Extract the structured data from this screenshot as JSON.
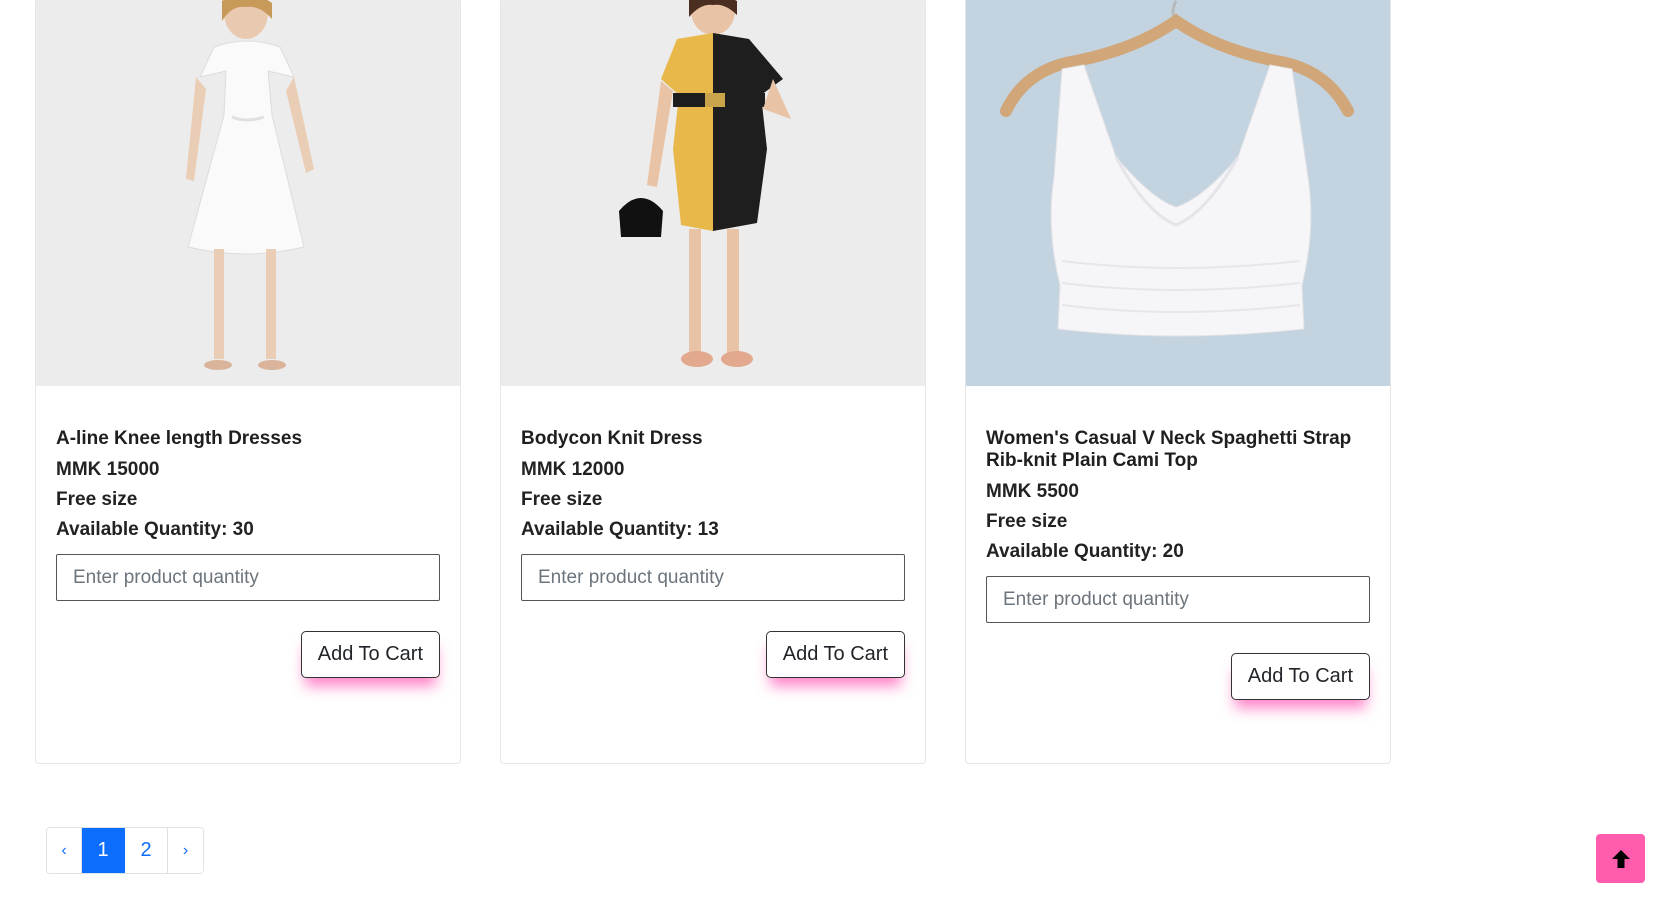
{
  "products": [
    {
      "name": "A-line Knee length Dresses",
      "price": "MMK 15000",
      "size": "Free size",
      "availability": "Available Quantity: 30",
      "quantity_placeholder": "Enter product quantity",
      "add_label": "Add To Cart"
    },
    {
      "name": "Bodycon Knit Dress",
      "price": "MMK 12000",
      "size": "Free size",
      "availability": "Available Quantity: 13",
      "quantity_placeholder": "Enter product quantity",
      "add_label": "Add To Cart"
    },
    {
      "name": "Women's Casual V Neck Spaghetti Strap Rib-knit Plain Cami Top",
      "price": "MMK 5500",
      "size": "Free size",
      "availability": "Available Quantity: 20",
      "quantity_placeholder": "Enter product quantity",
      "add_label": "Add To Cart"
    }
  ],
  "pagination": {
    "prev": "‹",
    "pages": [
      "1",
      "2"
    ],
    "active": "1",
    "next": "›"
  },
  "colors": {
    "accent_pink": "#ff5cae",
    "page_active": "#0d6efd"
  },
  "icons": {
    "scroll_top": "arrow-up-icon"
  }
}
